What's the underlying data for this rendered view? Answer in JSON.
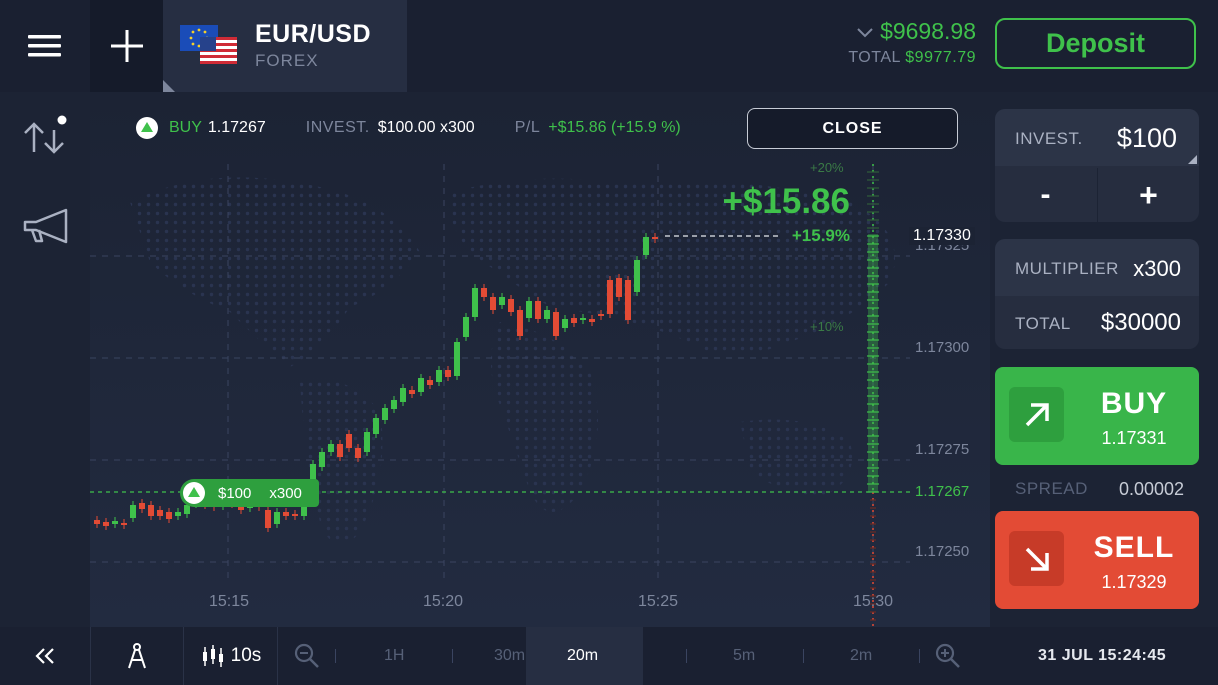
{
  "header": {
    "asset_name": "EUR/USD",
    "asset_type": "FOREX",
    "balance": "$9698.98",
    "total_label": "TOTAL",
    "total_value": "$9977.79",
    "deposit_label": "Deposit"
  },
  "position": {
    "direction": "BUY",
    "open_price": "1.17267",
    "invest_label": "INVEST.",
    "invest_value": "$100.00 x300",
    "pl_label": "P/L",
    "pl_value": "+$15.86 (+15.9 %)",
    "close_label": "CLOSE"
  },
  "chart": {
    "profit_amount": "+$15.86",
    "profit_percent": "+15.9%",
    "current_price_label": "1.17330",
    "marker_invest": "$100",
    "marker_mult": "x300",
    "pct_labels": [
      "+20%",
      "+10%"
    ],
    "price_labels": [
      "1.17325",
      "1.17300",
      "1.17275",
      "1.17267",
      "1.17250"
    ],
    "time_labels": [
      "15:15",
      "15:20",
      "15:25",
      "15:30"
    ]
  },
  "trade_panel": {
    "invest_label": "INVEST.",
    "invest_value": "$100",
    "minus_label": "-",
    "plus_label": "+",
    "multiplier_label": "MULTIPLIER",
    "multiplier_value": "x300",
    "total_label": "TOTAL",
    "total_value": "$30000",
    "buy_label": "BUY",
    "buy_price": "1.17331",
    "spread_label": "SPREAD",
    "spread_value": "0.00002",
    "sell_label": "SELL",
    "sell_price": "1.17329"
  },
  "bottom": {
    "candle_interval": "10s",
    "timeframes": [
      "1H",
      "30m",
      "20m",
      "5m",
      "2m"
    ],
    "active_timeframe": "20m",
    "datetime": "31 JUL 15:24:45"
  },
  "colors": {
    "green": "#3fc14b",
    "red": "#e34b35",
    "background": "#1c2334"
  }
}
